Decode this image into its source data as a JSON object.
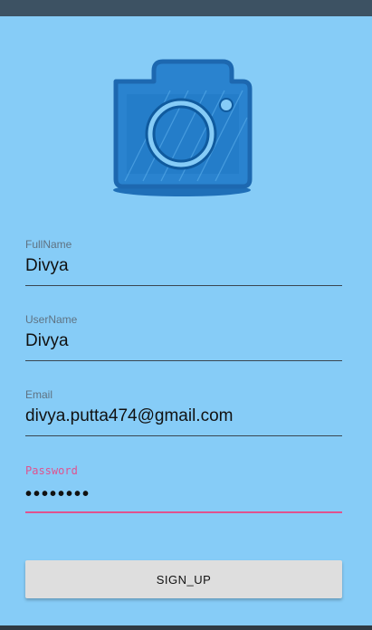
{
  "form": {
    "fullname": {
      "label": "FullName",
      "value": "Divya"
    },
    "username": {
      "label": "UserName",
      "value": "Divya"
    },
    "email": {
      "label": "Email",
      "value": "divya.putta474@gmail.com"
    },
    "password": {
      "label": "Password",
      "value": "••••••••"
    }
  },
  "signup_button": {
    "label": "SIGN_UP"
  },
  "colors": {
    "background": "#86ccf7",
    "accent": "#e0528f",
    "camera_blue": "#1f78c4"
  },
  "icons": {
    "logo": "camera-icon"
  }
}
